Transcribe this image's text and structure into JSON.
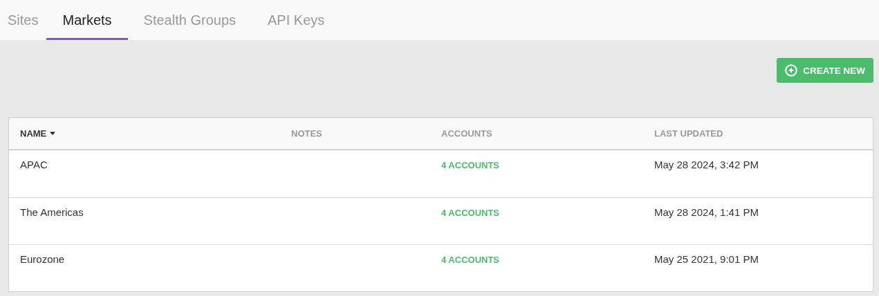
{
  "tabs": [
    {
      "label": "Sites",
      "selected": false
    },
    {
      "label": "Markets",
      "selected": true
    },
    {
      "label": "Stealth Groups",
      "selected": false
    },
    {
      "label": "API Keys",
      "selected": false
    }
  ],
  "create_button": {
    "label": "CREATE NEW"
  },
  "table": {
    "columns": [
      {
        "label": "NAME",
        "sorted": true
      },
      {
        "label": "NOTES",
        "sorted": false
      },
      {
        "label": "ACCOUNTS",
        "sorted": false
      },
      {
        "label": "LAST UPDATED",
        "sorted": false
      }
    ],
    "rows": [
      {
        "name": "APAC",
        "notes": "",
        "accounts": "4 ACCOUNTS",
        "last_updated": "May 28 2024, 3:42 PM"
      },
      {
        "name": "The Americas",
        "notes": "",
        "accounts": "4 ACCOUNTS",
        "last_updated": "May 28 2024, 1:41 PM"
      },
      {
        "name": "Eurozone",
        "notes": "",
        "accounts": "4 ACCOUNTS",
        "last_updated": "May 25 2021, 9:01 PM"
      }
    ]
  }
}
